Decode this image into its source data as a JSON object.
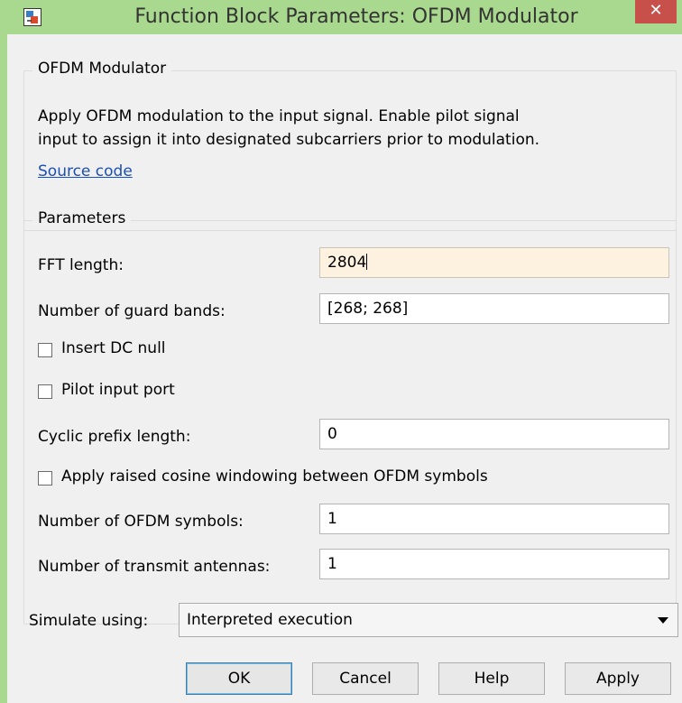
{
  "window": {
    "title": "Function Block Parameters: OFDM Modulator",
    "close_glyph": "✕"
  },
  "block_group": {
    "legend": "OFDM Modulator",
    "description_line1": "Apply OFDM modulation to the input signal. Enable pilot signal",
    "description_line2": "input to assign it into designated subcarriers prior to modulation.",
    "source_link": "Source code"
  },
  "params_group": {
    "legend": "Parameters",
    "fft_length": {
      "label": "FFT length:",
      "value": "2804"
    },
    "guard_bands": {
      "label": "Number of guard bands:",
      "value": "[268; 268]"
    },
    "insert_dc_null": {
      "label": "Insert DC null",
      "checked": false
    },
    "pilot_input_port": {
      "label": "Pilot input port",
      "checked": false
    },
    "cyclic_prefix": {
      "label": "Cyclic prefix length:",
      "value": "0"
    },
    "raised_cosine": {
      "label": "Apply raised cosine windowing between OFDM symbols",
      "checked": false
    },
    "num_symbols": {
      "label": "Number of OFDM symbols:",
      "value": "1"
    },
    "num_antennas": {
      "label": "Number of transmit antennas:",
      "value": "1"
    }
  },
  "simulate": {
    "label": "Simulate using:",
    "selected": "Interpreted execution"
  },
  "buttons": {
    "ok": "OK",
    "cancel": "Cancel",
    "help": "Help",
    "apply": "Apply"
  },
  "colors": {
    "title_bar": "#a9d98e",
    "close_button": "#c7504b",
    "link": "#1b4fb8",
    "active_field": "#fdf2e0"
  }
}
